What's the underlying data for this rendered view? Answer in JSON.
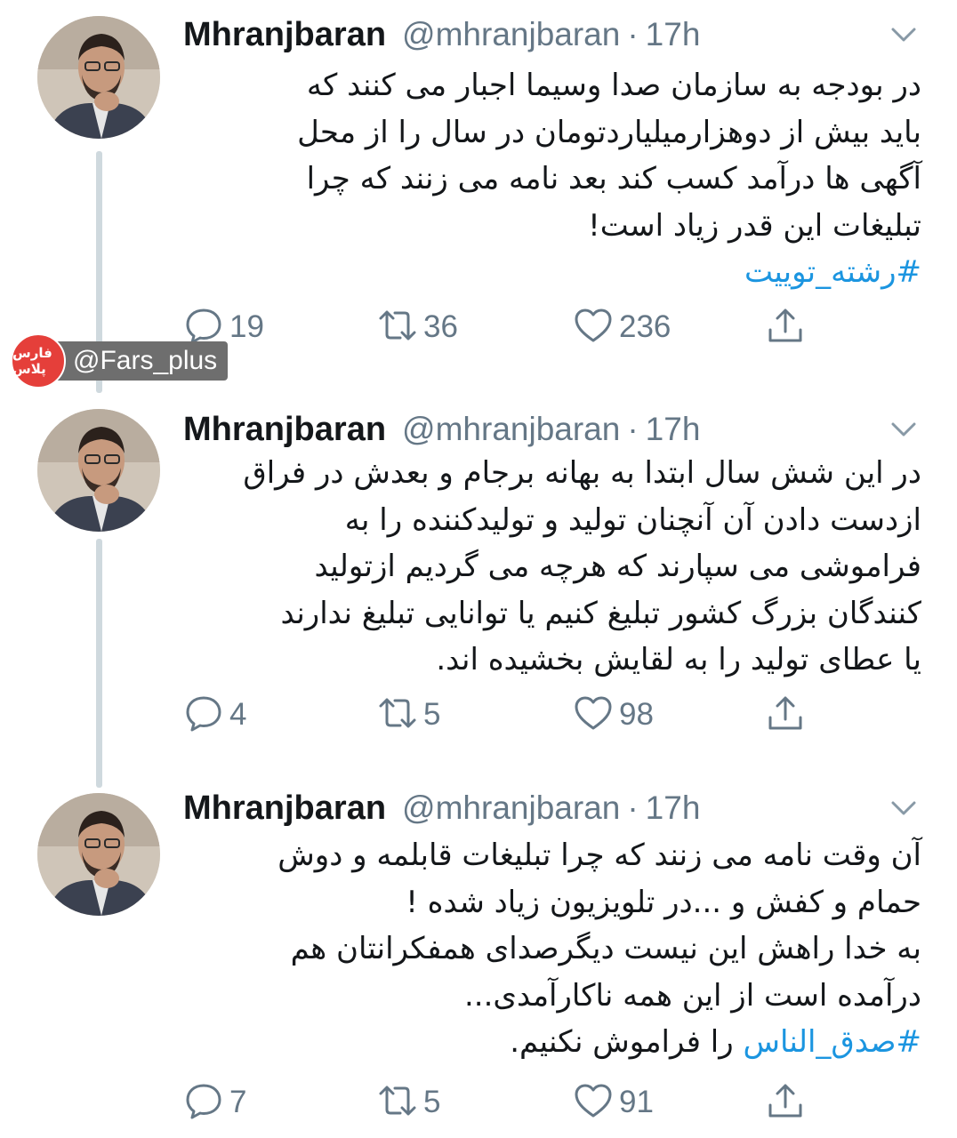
{
  "tweets": [
    {
      "name": "Mhranjbaran",
      "handle": "@mhranjbaran",
      "separator": "·",
      "time": "17h",
      "lines": [
        "در بودجه به سازمان صدا وسیما اجبار می کنند که",
        "باید بیش از دوهزارمیلیاردتومان در سال را از محل",
        "آگهی ها درآمد کسب کند بعد نامه می زنند که چرا",
        "تبلیغات این قدر زیاد است!"
      ],
      "hashtag_line": "#رشته_توییت",
      "replies": "19",
      "retweets": "36",
      "likes": "236"
    },
    {
      "name": "Mhranjbaran",
      "handle": "@mhranjbaran",
      "separator": "·",
      "time": "17h",
      "lines": [
        "در این شش سال ابتدا به بهانه برجام و بعدش در فراق",
        "ازدست دادن آن آنچنان تولید و تولیدکننده را به",
        "فراموشی می سپارند که هرچه می گردیم ازتولید",
        "کنندگان بزرگ کشور تبلیغ کنیم یا توانایی تبلیغ ندارند",
        "یا عطای تولید را به لقایش بخشیده اند."
      ],
      "replies": "4",
      "retweets": "5",
      "likes": "98"
    },
    {
      "name": "Mhranjbaran",
      "handle": "@mhranjbaran",
      "separator": "·",
      "time": "17h",
      "lines": [
        "آن وقت نامه می زنند که چرا تبلیغات قابلمه و دوش",
        "حمام و کفش و ...در تلویزیون زیاد شده !",
        "به خدا راهش این نیست دیگرصدای همفکرانتان هم",
        "درآمده است از این همه ناکارآمدی..."
      ],
      "hashtag": "#صدق_الناس",
      "hashtag_suffix": " را فراموش نکنیم.",
      "replies": "7",
      "retweets": "5",
      "likes": "91"
    }
  ],
  "watermark": {
    "badge_text": "فارس پلاس",
    "label": "@Fars_plus"
  },
  "colors": {
    "hashtag": "#1b95e0",
    "secondary_text": "#657786",
    "thread_line": "#cfd9de",
    "watermark_badge": "#e53f3a"
  },
  "icons": [
    "chevron-down-icon",
    "reply-icon",
    "retweet-icon",
    "like-icon",
    "share-icon"
  ]
}
